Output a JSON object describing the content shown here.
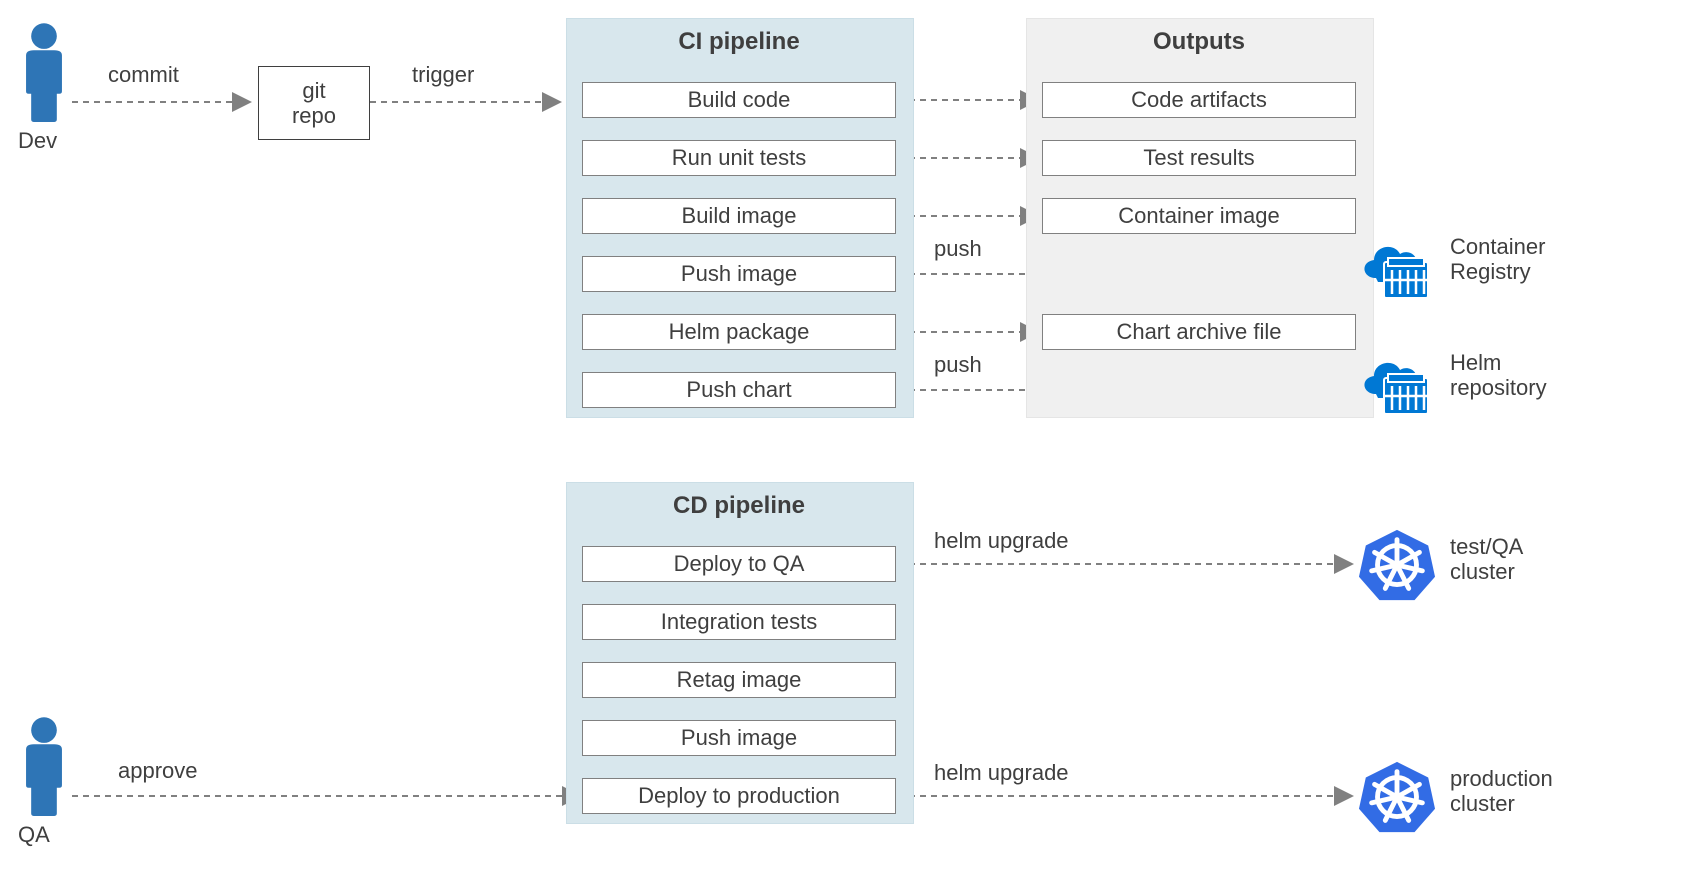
{
  "actors": {
    "dev": "Dev",
    "qa": "QA"
  },
  "git_box": "git\nrepo",
  "edge_labels": {
    "commit": "commit",
    "trigger": "trigger",
    "push1": "push",
    "push2": "push",
    "helm_upgrade1": "helm upgrade",
    "helm_upgrade2": "helm upgrade",
    "approve": "approve"
  },
  "panels": {
    "ci": {
      "title": "CI pipeline",
      "steps": [
        "Build code",
        "Run unit tests",
        "Build image",
        "Push image",
        "Helm package",
        "Push chart"
      ]
    },
    "outputs": {
      "title": "Outputs",
      "items": [
        "Code artifacts",
        "Test results",
        "Container image",
        "Chart archive file"
      ]
    },
    "cd": {
      "title": "CD pipeline",
      "steps": [
        "Deploy to QA",
        "Integration tests",
        "Retag image",
        "Push image",
        "Deploy to production"
      ]
    }
  },
  "icons": {
    "registry": "Container\nRegistry",
    "helm_repo": "Helm\nrepository",
    "qa_cluster": "test/QA\ncluster",
    "prod_cluster": "production\ncluster"
  },
  "colors": {
    "panel_ci_bg": "#d8e7ed",
    "panel_ci_border": "#cbdee6",
    "panel_out_bg": "#f0f0f0",
    "panel_out_border": "#e5e5e5",
    "azure_blue": "#0078d4",
    "k8s_blue": "#326ce5",
    "person_blue": "#2e75b6"
  }
}
